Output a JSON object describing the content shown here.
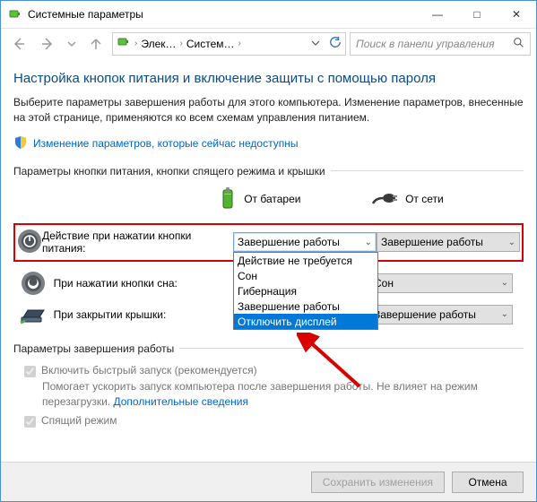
{
  "window": {
    "title": "Системные параметры",
    "minimize_glyph": "—",
    "maximize_glyph": "□",
    "close_glyph": "✕"
  },
  "nav": {
    "breadcrumb_item1": "Элек…",
    "breadcrumb_item2": "Систем…",
    "chevron": "›",
    "down": "⌄",
    "search_placeholder": "Поиск в панели управления",
    "search_icon": "🔍",
    "refresh_icon": "⟳"
  },
  "heading": "Настройка кнопок питания и включение защиты с помощью пароля",
  "description": "Выберите параметры завершения работы для этого компьютера. Изменение параметров, внесенные на этой странице, применяются ко всем схемам управления питанием.",
  "shield_link": "Изменение параметров, которые сейчас недоступны",
  "group1_title": "Параметры кнопки питания, кнопки спящего режима и крышки",
  "cols": {
    "battery": "От батареи",
    "mains": "От сети"
  },
  "rows": {
    "power": {
      "label": "Действие при нажатии кнопки питания:",
      "battery_value": "Завершение работы",
      "mains_value": "Завершение работы"
    },
    "sleep": {
      "label": "При нажатии кнопки сна:",
      "battery_value": "Сон",
      "mains_value": "Сон"
    },
    "lid": {
      "label": "При закрытии крышки:",
      "battery_value": "Завершение работы",
      "mains_value": "Завершение работы"
    }
  },
  "dropdown_options": [
    "Действие не требуется",
    "Сон",
    "Гибернация",
    "Завершение работы",
    "Отключить дисплей"
  ],
  "group2_title": "Параметры завершения работы",
  "fastboot": {
    "label": "Включить быстрый запуск (рекомендуется)",
    "desc1": "Помогает ускорить запуск компьютера после завершения работы. Не влияет на режим перезагрузки. ",
    "link": "Дополнительные сведения"
  },
  "sleepmode": {
    "label": "Спящий режим"
  },
  "footer": {
    "save": "Сохранить изменения",
    "cancel": "Отмена"
  }
}
